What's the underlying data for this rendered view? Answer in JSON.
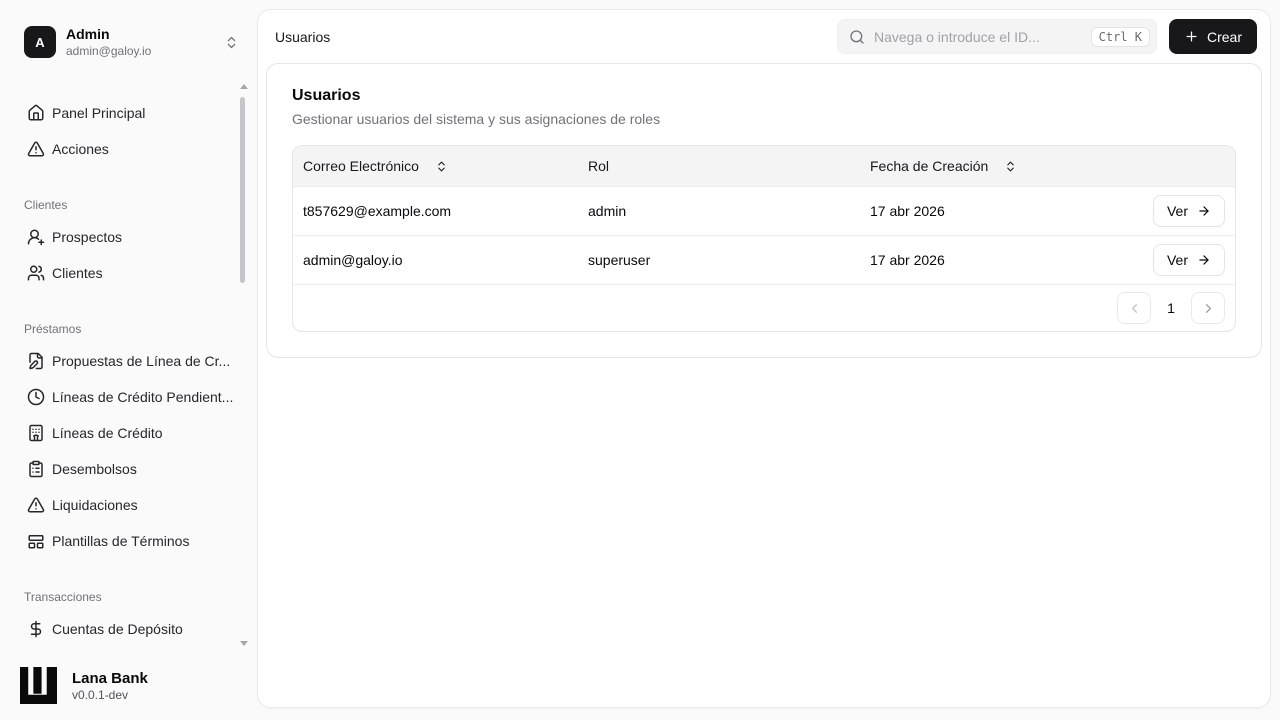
{
  "colors": {
    "accent": "#18181b",
    "page_bg": "#fafafa",
    "panel_bg": "#ffffff",
    "border": "#e4e4e7",
    "muted_text": "#71717a",
    "table_header_bg": "#f4f4f5"
  },
  "sidebar": {
    "user": {
      "initial": "A",
      "name": "Admin",
      "email": "admin@galoy.io"
    },
    "groups": [
      {
        "label": "",
        "items": [
          {
            "icon": "home-icon",
            "label": "Panel Principal"
          },
          {
            "icon": "alert-triangle-icon",
            "label": "Acciones"
          }
        ]
      },
      {
        "label": "Clientes",
        "items": [
          {
            "icon": "user-plus-icon",
            "label": "Prospectos"
          },
          {
            "icon": "users-icon",
            "label": "Clientes"
          }
        ]
      },
      {
        "label": "Préstamos",
        "items": [
          {
            "icon": "file-pen-icon",
            "label": "Propuestas de Línea de Cr..."
          },
          {
            "icon": "clock-icon",
            "label": "Líneas de Crédito Pendient..."
          },
          {
            "icon": "bank-icon",
            "label": "Líneas de Crédito"
          },
          {
            "icon": "clipboard-list-icon",
            "label": "Desembolsos"
          },
          {
            "icon": "alert-triangle-icon",
            "label": "Liquidaciones"
          },
          {
            "icon": "layout-panel-icon",
            "label": "Plantillas de Términos"
          }
        ]
      },
      {
        "label": "Transacciones",
        "items": [
          {
            "icon": "dollar-icon",
            "label": "Cuentas de Depósito"
          }
        ]
      }
    ],
    "footer": {
      "brand": "Lana Bank",
      "version": "v0.0.1-dev"
    }
  },
  "header": {
    "breadcrumb": "Usuarios",
    "search": {
      "placeholder": "Navega o introduce el ID...",
      "shortcut": "Ctrl K"
    },
    "create_button": "Crear"
  },
  "users": {
    "title": "Usuarios",
    "subtitle": "Gestionar usuarios del sistema y sus asignaciones de roles",
    "table": {
      "columns": [
        "Correo Electrónico",
        "Rol",
        "Fecha de Creación"
      ],
      "rows": [
        {
          "email": "t857629@example.com",
          "role": "admin",
          "created": "17 abr 2026",
          "action": "Ver"
        },
        {
          "email": "admin@galoy.io",
          "role": "superuser",
          "created": "17 abr 2026",
          "action": "Ver"
        }
      ],
      "pagination": {
        "current_page": "1"
      }
    }
  }
}
